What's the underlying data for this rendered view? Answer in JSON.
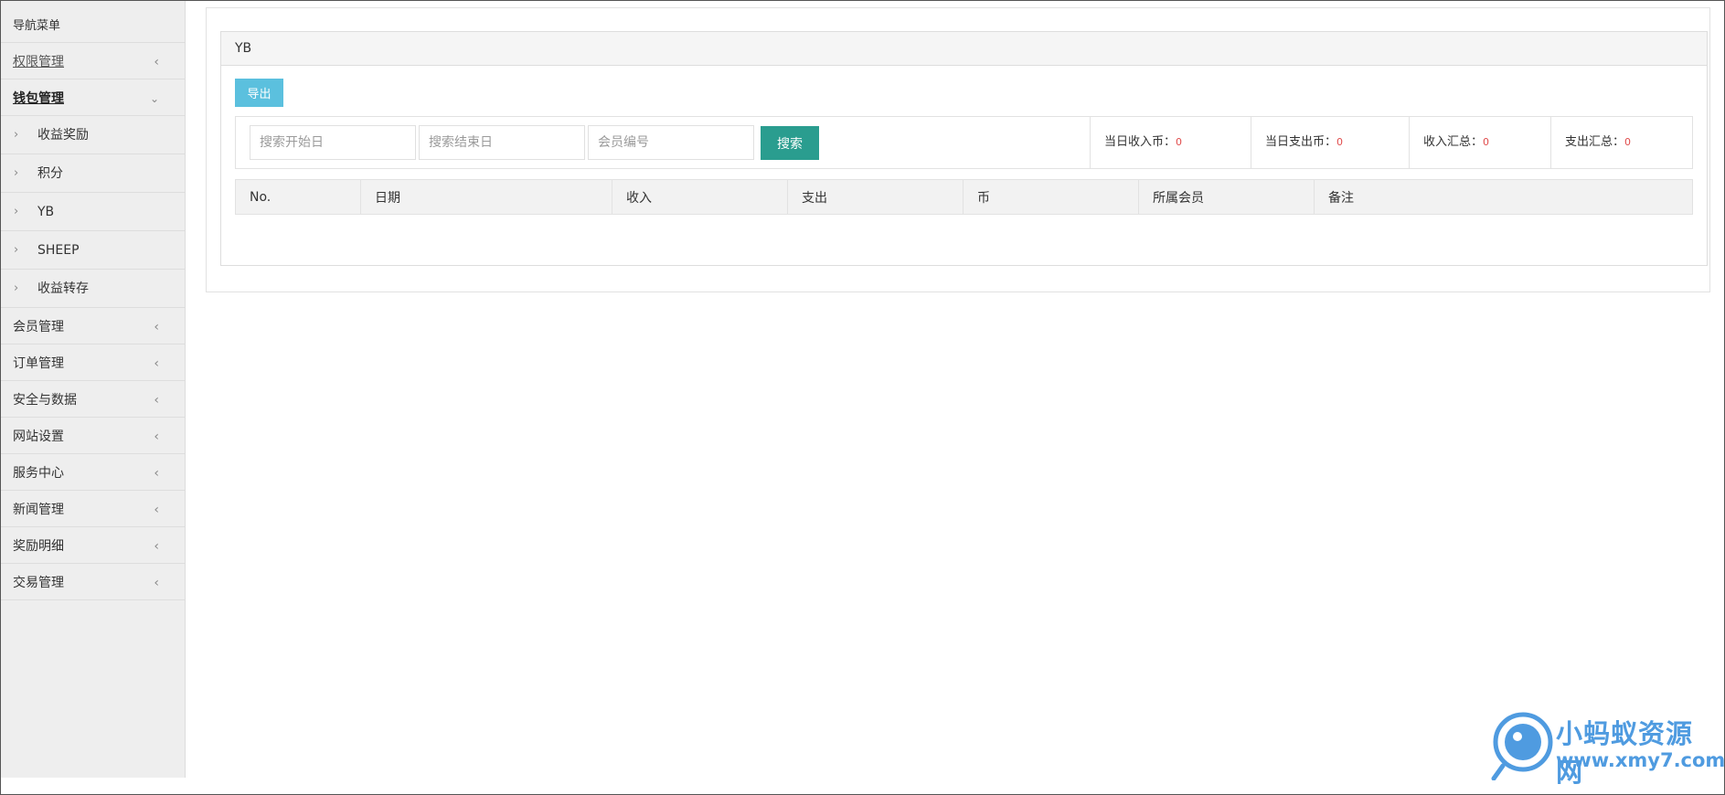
{
  "sidebar": {
    "title": "导航菜单",
    "items": [
      {
        "label": "权限管理",
        "state": "link"
      },
      {
        "label": "钱包管理",
        "state": "open"
      }
    ],
    "sub_items": [
      {
        "label": "收益奖励"
      },
      {
        "label": "积分"
      },
      {
        "label": "YB"
      },
      {
        "label": "SHEEP"
      },
      {
        "label": "收益转存"
      }
    ],
    "rest_items": [
      {
        "label": "会员管理"
      },
      {
        "label": "订单管理"
      },
      {
        "label": "安全与数据"
      },
      {
        "label": "网站设置"
      },
      {
        "label": "服务中心"
      },
      {
        "label": "新闻管理"
      },
      {
        "label": "奖励明细"
      },
      {
        "label": "交易管理"
      }
    ]
  },
  "panel": {
    "title": "YB",
    "export_label": "导出",
    "search": {
      "start_placeholder": "搜索开始日",
      "end_placeholder": "搜索结束日",
      "member_placeholder": "会员编号",
      "button_label": "搜索"
    },
    "stats": [
      {
        "label": "当日收入币：",
        "value": "0"
      },
      {
        "label": "当日支出币：",
        "value": "0"
      },
      {
        "label": "收入汇总：",
        "value": "0"
      },
      {
        "label": "支出汇总：",
        "value": "0"
      }
    ],
    "columns": [
      "No.",
      "日期",
      "收入",
      "支出",
      "币",
      "所属会员",
      "备注"
    ]
  },
  "watermark": {
    "title": "小蚂蚁资源网",
    "url": "www.xmy7.com"
  },
  "colors": {
    "export_button": "#5bc0de",
    "search_button": "#2a9d8f",
    "stat_value": "#e04b4b",
    "watermark": "#4f9be0"
  }
}
